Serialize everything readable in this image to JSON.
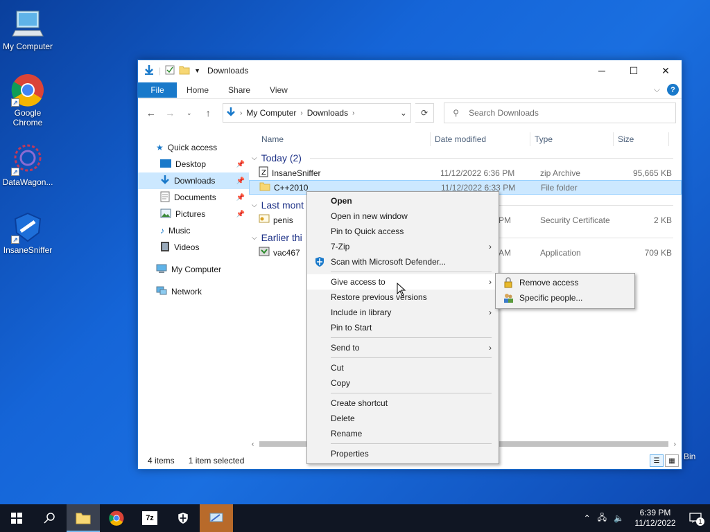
{
  "desktop": {
    "icons": [
      {
        "label": "My Computer"
      },
      {
        "label": "Google Chrome"
      },
      {
        "label": "DataWagon..."
      },
      {
        "label": "InsaneSniffer"
      }
    ],
    "recycle_bin_partial_label": "Bin"
  },
  "window": {
    "title": "Downloads",
    "ribbon": {
      "file": "File",
      "home": "Home",
      "share": "Share",
      "view": "View",
      "help": "?"
    },
    "address": {
      "segments": [
        "My Computer",
        "Downloads"
      ]
    },
    "search": {
      "placeholder": "Search Downloads"
    },
    "navpane": [
      {
        "label": "Quick access"
      },
      {
        "label": "Desktop"
      },
      {
        "label": "Downloads"
      },
      {
        "label": "Documents"
      },
      {
        "label": "Pictures"
      },
      {
        "label": "Music"
      },
      {
        "label": "Videos"
      },
      {
        "label": "My Computer"
      },
      {
        "label": "Network"
      }
    ],
    "columns": {
      "name": "Name",
      "date": "Date modified",
      "type": "Type",
      "size": "Size"
    },
    "groups": [
      {
        "label": "Today (2)"
      },
      {
        "label": "Last mont"
      },
      {
        "label": "Earlier thi"
      }
    ],
    "rows": [
      {
        "name": "InsaneSniffer",
        "date": "11/12/2022 6:36 PM",
        "type": "zip Archive",
        "size": "95,665 KB"
      },
      {
        "name": "C++2010",
        "date": "11/12/2022 6:33 PM",
        "type": "File folder",
        "size": ""
      },
      {
        "name": "penis",
        "date": "PM",
        "type": "Security Certificate",
        "size": "2 KB"
      },
      {
        "name": "vac467",
        "date": "AM",
        "type": "Application",
        "size": "709 KB"
      }
    ],
    "status": {
      "items": "4 items",
      "selected": "1 item selected"
    }
  },
  "context_menu": {
    "items": [
      {
        "label": "Open"
      },
      {
        "label": "Open in new window"
      },
      {
        "label": "Pin to Quick access"
      },
      {
        "label": "7-Zip"
      },
      {
        "label": "Scan with Microsoft Defender..."
      },
      {
        "label": "Give access to"
      },
      {
        "label": "Restore previous versions"
      },
      {
        "label": "Include in library"
      },
      {
        "label": "Pin to Start"
      },
      {
        "label": "Send to"
      },
      {
        "label": "Cut"
      },
      {
        "label": "Copy"
      },
      {
        "label": "Create shortcut"
      },
      {
        "label": "Delete"
      },
      {
        "label": "Rename"
      },
      {
        "label": "Properties"
      }
    ]
  },
  "submenu": {
    "items": [
      {
        "label": "Remove access"
      },
      {
        "label": "Specific people..."
      }
    ]
  },
  "taskbar": {
    "time": "6:39 PM",
    "date": "11/12/2022",
    "notification_count": "1",
    "sevenzip_label": "7z"
  }
}
